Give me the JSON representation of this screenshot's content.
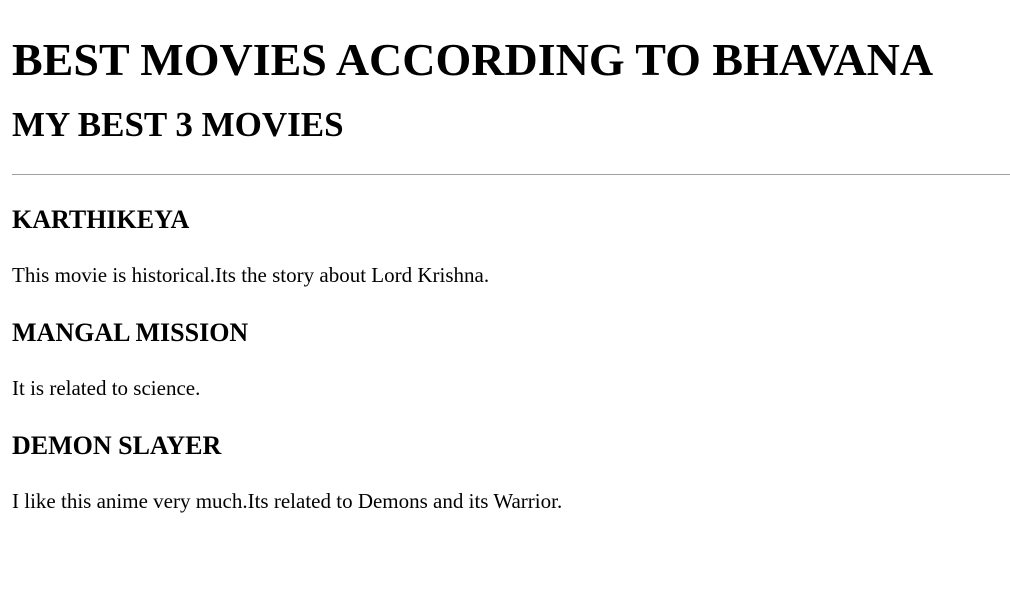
{
  "page": {
    "title": "BEST MOVIES ACCORDING TO BHAVANA",
    "subtitle": "MY BEST 3 MOVIES"
  },
  "movies": [
    {
      "name": "KARTHIKEYA",
      "description": "This movie is historical.Its the story about Lord Krishna."
    },
    {
      "name": "MANGAL MISSION",
      "description": "It is related to science."
    },
    {
      "name": "DEMON SLAYER",
      "description": "I like this anime very much.Its related to Demons and its Warrior."
    }
  ]
}
